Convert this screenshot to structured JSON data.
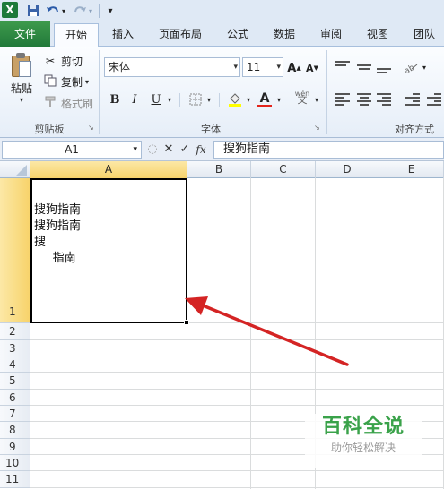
{
  "app": {
    "logo_letter": "X"
  },
  "qat": {
    "save_icon": "save-icon",
    "undo_icon": "undo-icon",
    "redo_icon": "redo-icon",
    "customize_icon": "customize-icon"
  },
  "tabs": [
    {
      "label": "文件"
    },
    {
      "label": "开始"
    },
    {
      "label": "插入"
    },
    {
      "label": "页面布局"
    },
    {
      "label": "公式"
    },
    {
      "label": "数据"
    },
    {
      "label": "审阅"
    },
    {
      "label": "视图"
    },
    {
      "label": "团队"
    }
  ],
  "ribbon": {
    "clipboard": {
      "paste_label": "粘贴",
      "cut_label": "剪切",
      "copy_label": "复制",
      "format_painter_label": "格式刷",
      "group_label": "剪贴板"
    },
    "font": {
      "font_name": "宋体",
      "font_size": "11",
      "bold": "B",
      "italic": "I",
      "underline": "U",
      "font_color_letter": "A",
      "phonetic": "wén",
      "group_label": "字体",
      "accent_color": "#e3241b"
    },
    "alignment": {
      "group_label": "对齐方式"
    }
  },
  "formula_bar": {
    "name_box": "A1",
    "cancel": "✕",
    "enter": "✓",
    "fx": "fx",
    "content": "搜狗指南"
  },
  "grid": {
    "columns": [
      "A",
      "B",
      "C",
      "D",
      "E"
    ],
    "rows": [
      "1",
      "2",
      "3",
      "4",
      "5",
      "6",
      "7",
      "8",
      "9",
      "10",
      "11"
    ],
    "cell_a1_lines": [
      "搜狗指南",
      "搜狗指南",
      "搜",
      "     指南"
    ],
    "selected_cell": "A1"
  },
  "watermark": {
    "title": "百科全说",
    "subtitle": "助你轻松解决",
    "color": "#3aa24a"
  },
  "annotation": {
    "color": "#d42424"
  }
}
